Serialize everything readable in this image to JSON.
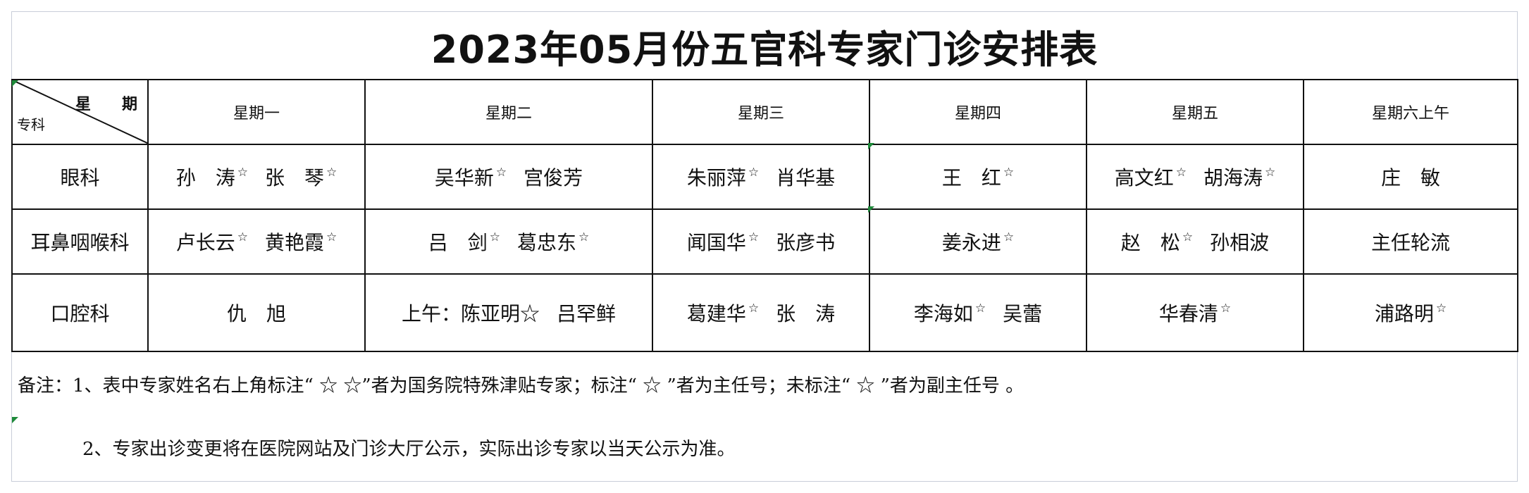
{
  "title": "2023年05月份五官科专家门诊安排表",
  "corner": {
    "top_label": "星　　期",
    "bottom_label": "专科"
  },
  "days": [
    "星期一",
    "星期二",
    "星期三",
    "星期四",
    "星期五",
    "星期六上午"
  ],
  "rows": [
    {
      "dept": "眼科",
      "cells": [
        [
          {
            "name": "孙　涛",
            "star": "☆"
          },
          {
            "name": "张　琴",
            "star": "☆"
          }
        ],
        [
          {
            "name": "吴华新",
            "star": "☆"
          },
          {
            "name": "宫俊芳",
            "star": ""
          }
        ],
        [
          {
            "name": "朱丽萍",
            "star": "☆"
          },
          {
            "name": "肖华基",
            "star": ""
          }
        ],
        [
          {
            "name": "王　红",
            "star": "☆"
          }
        ],
        [
          {
            "name": "高文红",
            "star": "☆"
          },
          {
            "name": "胡海涛",
            "star": "☆"
          }
        ],
        [
          {
            "name": "庄　敏",
            "star": ""
          }
        ]
      ]
    },
    {
      "dept": "耳鼻咽喉科",
      "cells": [
        [
          {
            "name": "卢长云",
            "star": "☆"
          },
          {
            "name": "黄艳霞",
            "star": "☆"
          }
        ],
        [
          {
            "name": "吕　剑",
            "star": "☆"
          },
          {
            "name": "葛忠东",
            "star": "☆"
          }
        ],
        [
          {
            "name": "闻国华",
            "star": "☆"
          },
          {
            "name": "张彦书",
            "star": ""
          }
        ],
        [
          {
            "name": "姜永进",
            "star": "☆"
          }
        ],
        [
          {
            "name": "赵　松",
            "star": "☆"
          },
          {
            "name": "孙相波",
            "star": ""
          }
        ],
        [
          {
            "name": "主任轮流",
            "star": ""
          }
        ]
      ]
    },
    {
      "dept": "口腔科",
      "cells": [
        [
          {
            "name": "仇　旭",
            "star": ""
          }
        ],
        [
          {
            "name": "上午：陈亚明☆",
            "star": ""
          },
          {
            "name": "吕罕鲜",
            "star": ""
          }
        ],
        [
          {
            "name": "葛建华",
            "star": "☆"
          },
          {
            "name": "张　涛",
            "star": ""
          }
        ],
        [
          {
            "name": "李海如",
            "star": "☆"
          },
          {
            "name": "吴蕾",
            "star": ""
          }
        ],
        [
          {
            "name": "华春清",
            "star": "☆"
          }
        ],
        [
          {
            "name": "浦路明",
            "star": "☆"
          }
        ]
      ]
    }
  ],
  "notes": {
    "note1": "备注：1、表中专家姓名右上角标注“ ☆ ☆”者为国务院特殊津贴专家；标注“ ☆ ”者为主任号；未标注“ ☆ ”者为副主任号 。",
    "note2": "2、专家出诊变更将在医院网站及门诊大厅公示，实际出诊专家以当天公示为准。"
  }
}
